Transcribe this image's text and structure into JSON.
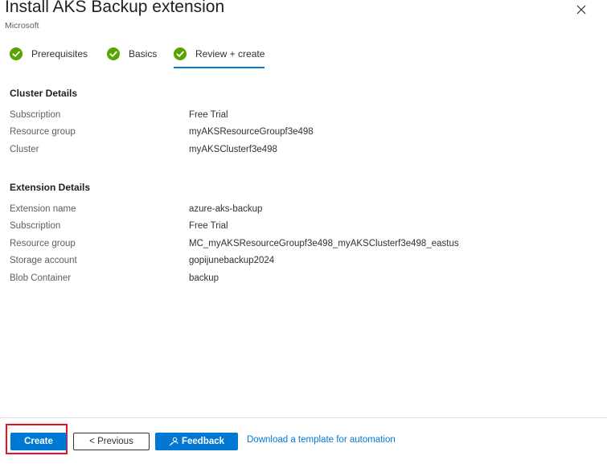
{
  "header": {
    "title": "Install AKS Backup extension",
    "publisher": "Microsoft"
  },
  "tabs": [
    {
      "label": "Prerequisites",
      "status": "complete",
      "icon": "check-circle-icon"
    },
    {
      "label": "Basics",
      "status": "complete",
      "icon": "check-circle-icon"
    },
    {
      "label": "Review + create",
      "status": "complete",
      "active": true,
      "icon": "check-circle-icon"
    }
  ],
  "cluster_details": {
    "title": "Cluster Details",
    "rows": [
      {
        "key": "Subscription",
        "value": "Free Trial"
      },
      {
        "key": "Resource group",
        "value": "myAKSResourceGroupf3e498"
      },
      {
        "key": "Cluster",
        "value": "myAKSClusterf3e498"
      }
    ]
  },
  "extension_details": {
    "title": "Extension Details",
    "rows": [
      {
        "key": "Extension name",
        "value": "azure-aks-backup"
      },
      {
        "key": "Subscription",
        "value": "Free Trial"
      },
      {
        "key": "Resource group",
        "value": "MC_myAKSResourceGroupf3e498_myAKSClusterf3e498_eastus"
      },
      {
        "key": "Storage account",
        "value": "gopijunebackup2024"
      },
      {
        "key": "Blob Container",
        "value": "backup"
      }
    ]
  },
  "footer": {
    "create_label": "Create",
    "previous_label": "< Previous",
    "feedback_label": "Feedback",
    "template_link": "Download a template for automation"
  },
  "colors": {
    "accent": "#0078d4",
    "success": "#57a300",
    "highlight": "#e81123"
  }
}
